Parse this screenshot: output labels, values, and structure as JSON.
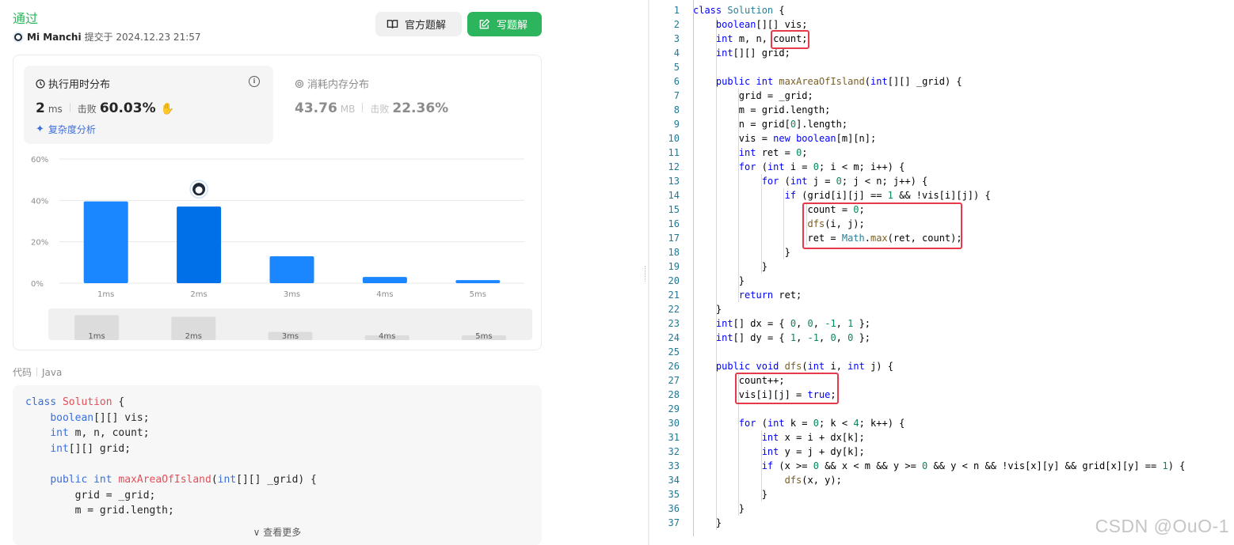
{
  "submission": {
    "status": "通过",
    "user": "Mi Manchi",
    "submitted_at": "提交于 2024.12.23 21:57"
  },
  "buttons": {
    "official": "官方题解",
    "write": "写题解"
  },
  "runtime": {
    "title": "执行用时分布",
    "value": "2",
    "unit": "ms",
    "beat_label": "击败",
    "beat": "60.03%",
    "complexity_link": "复杂度分析"
  },
  "memory": {
    "title": "消耗内存分布",
    "value": "43.76",
    "unit": "MB",
    "beat_label": "击败",
    "beat": "22.36%"
  },
  "chart_data": {
    "type": "bar",
    "categories": [
      "1ms",
      "2ms",
      "3ms",
      "4ms",
      "5ms"
    ],
    "values": [
      39.5,
      37,
      13,
      3,
      1.5
    ],
    "yticks": [
      "0%",
      "20%",
      "40%",
      "60%"
    ],
    "ylim": [
      0,
      60
    ],
    "highlight_index": 1,
    "colors": {
      "bar": "#1a86ff",
      "highlight": "#0070e8",
      "grid": "#e8e8e8"
    }
  },
  "overview": {
    "labels": [
      "1ms",
      "2ms",
      "3ms",
      "4ms",
      "5ms"
    ]
  },
  "code_section": {
    "label": "代码",
    "language": "Java",
    "more": "查看更多"
  },
  "preview_code": [
    "class Solution {",
    "    boolean[][] vis;",
    "    int m, n, count;",
    "    int[][] grid;",
    "",
    "    public int maxAreaOfIsland(int[][] _grid) {",
    "        grid = _grid;",
    "        m = grid.length;"
  ],
  "editor": {
    "line_numbers": [
      "1",
      "2",
      "3",
      "4",
      "5",
      "6",
      "7",
      "8",
      "9",
      "10",
      "11",
      "12",
      "13",
      "14",
      "15",
      "16",
      "17",
      "18",
      "19",
      "20",
      "21",
      "22",
      "23",
      "24",
      "25",
      "26",
      "27",
      "28",
      "29",
      "30",
      "31",
      "32",
      "33",
      "34",
      "35",
      "36",
      "37"
    ],
    "lines": [
      "class Solution {",
      "    boolean[][] vis;",
      "    int m, n, count;",
      "    int[][] grid;",
      "",
      "    public int maxAreaOfIsland(int[][] _grid) {",
      "        grid = _grid;",
      "        m = grid.length;",
      "        n = grid[0].length;",
      "        vis = new boolean[m][n];",
      "        int ret = 0;",
      "        for (int i = 0; i < m; i++) {",
      "            for (int j = 0; j < n; j++) {",
      "                if (grid[i][j] == 1 && !vis[i][j]) {",
      "                    count = 0;",
      "                    dfs(i, j);",
      "                    ret = Math.max(ret, count);",
      "                }",
      "            }",
      "        }",
      "        return ret;",
      "    }",
      "    int[] dx = { 0, 0, -1, 1 };",
      "    int[] dy = { 1, -1, 0, 0 };",
      "",
      "    public void dfs(int i, int j) {",
      "        count++;",
      "        vis[i][j] = true;",
      "",
      "        for (int k = 0; k < 4; k++) {",
      "            int x = i + dx[k];",
      "            int y = j + dy[k];",
      "            if (x >= 0 && x < m && y >= 0 && y < n && !vis[x][y] && grid[x][y] == 1) {",
      "                dfs(x, y);",
      "            }",
      "        }",
      "    }"
    ]
  },
  "watermark": "CSDN @OuO-1"
}
